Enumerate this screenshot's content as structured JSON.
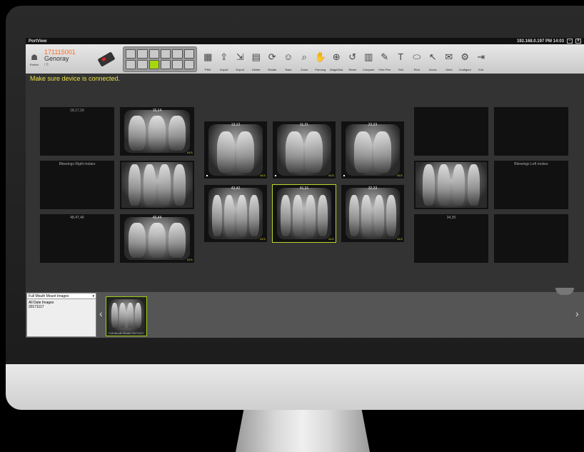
{
  "titlebar": {
    "app_name": "PortView",
    "ip_time": "192.168.0.197  PM 14:03",
    "minimize_glyph": "–",
    "close_glyph": "X"
  },
  "patient": {
    "caption": "Patient",
    "id": "171115001",
    "name": "Genoray",
    "sub": "/ 0"
  },
  "tools": [
    {
      "label": "PMX",
      "icon": "pmx-icon",
      "glyph": "▦"
    },
    {
      "label": "Import",
      "icon": "import-icon",
      "glyph": "⇪"
    },
    {
      "label": "Export",
      "icon": "export-icon",
      "glyph": "⇲"
    },
    {
      "label": "Delete",
      "icon": "delete-icon",
      "glyph": "▤"
    },
    {
      "label": "Rotate",
      "icon": "rotate-icon",
      "glyph": "⟳"
    },
    {
      "label": "Team",
      "icon": "team-icon",
      "glyph": "☺"
    },
    {
      "label": "Zoom",
      "icon": "zoom-icon",
      "glyph": "⌕"
    },
    {
      "label": "Panning",
      "icon": "panning-icon",
      "glyph": "✋"
    },
    {
      "label": "MagnGlas",
      "icon": "magnifier-icon",
      "glyph": "⊕"
    },
    {
      "label": "Reset",
      "icon": "reset-icon",
      "glyph": "↺"
    },
    {
      "label": "Compare",
      "icon": "compare-icon",
      "glyph": "▥"
    },
    {
      "label": "Free Pen",
      "icon": "pen-icon",
      "glyph": "✎"
    },
    {
      "label": "Text",
      "icon": "text-icon",
      "glyph": "T"
    },
    {
      "label": "Rect",
      "icon": "rect-icon",
      "glyph": "⬭"
    },
    {
      "label": "Arrow",
      "icon": "arrow-icon",
      "glyph": "↖"
    },
    {
      "label": "Send",
      "icon": "send-icon",
      "glyph": "✉"
    },
    {
      "label": "Configure",
      "icon": "configure-icon",
      "glyph": "⚙"
    },
    {
      "label": "Exit",
      "icon": "exit-icon",
      "glyph": "⇥"
    }
  ],
  "status_message": "Make sure device is connected.",
  "slots": {
    "s181716": "18,17,16",
    "bw_right": "Bitewings Right molars",
    "s484746": "48,47,46",
    "bw_left": "Bitewings Left molars",
    "s3435": "34,35"
  },
  "xrays": {
    "x1514": {
      "label": "15,14",
      "tag": "#1/1"
    },
    "x1312": {
      "label": "13,12",
      "tag": "#1/1"
    },
    "x1121": {
      "label": "11,21",
      "tag": "#1/1"
    },
    "x2223": {
      "label": "22,23",
      "tag": "#1/1"
    },
    "x4342": {
      "label": "43,42",
      "tag": "#1/1"
    },
    "x4131": {
      "label": "41,31",
      "tag": "#1/1"
    },
    "x3233": {
      "label": "32,33",
      "tag": "#1/1"
    },
    "x4544": {
      "label": "45,44",
      "tag": "#1/1"
    }
  },
  "browser": {
    "dropdown_value": "Full Mouth Mount Images",
    "list": [
      "All Date Images",
      "20171117"
    ],
    "thumb_caption": "Full Mouth Mount 20171117"
  }
}
